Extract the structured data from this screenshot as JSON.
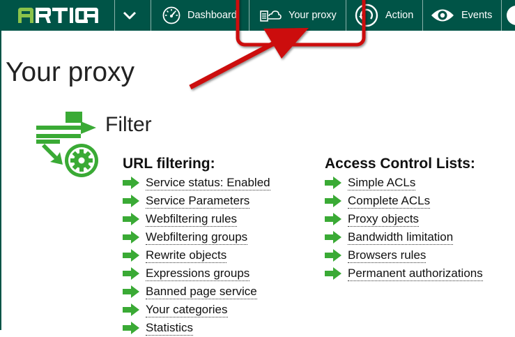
{
  "navbar": {
    "logo_text": "ARTICA",
    "items": [
      {
        "label": "Dashboard",
        "icon": "speedometer-icon"
      },
      {
        "label": "Your proxy",
        "icon": "proxy-cloud-icon"
      },
      {
        "label": "Action",
        "icon": "action-refresh-icon"
      },
      {
        "label": "Events",
        "icon": "eye-icon"
      }
    ],
    "menu_icon": "chevron-down-icon",
    "colors": {
      "background": "#005447",
      "logo_accent": "#8bc34a",
      "text": "#ffffff"
    }
  },
  "page": {
    "title": "Your proxy",
    "section": {
      "title": "Filter",
      "icon": "filter-gear-icon",
      "icon_color": "#3aaa35"
    }
  },
  "url_filtering": {
    "heading": "URL filtering:",
    "links": [
      "Service status: Enabled",
      "Service Parameters",
      "Webfiltering rules",
      "Webfiltering groups",
      "Rewrite objects",
      "Expressions groups",
      "Banned page service",
      "Your categories",
      "Statistics"
    ]
  },
  "acl": {
    "heading": "Access Control Lists:",
    "links": [
      "Simple ACLs",
      "Complete ACLs",
      "Proxy objects",
      "Bandwidth limitation",
      "Browsers rules",
      "Permanent authorizations"
    ]
  },
  "link_icon": "green-arrow-icon",
  "callout": {
    "color": "#cc1111",
    "shapes": [
      "highlight-rectangle",
      "pointer-arrow"
    ]
  }
}
